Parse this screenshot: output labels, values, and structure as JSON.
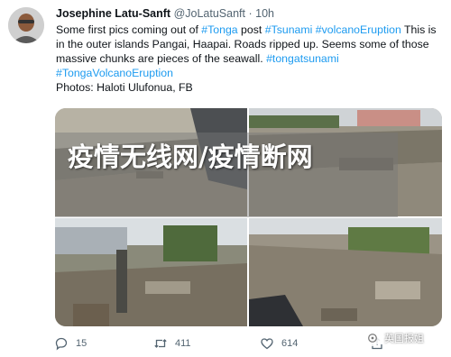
{
  "tweet": {
    "name": "Josephine Latu-Sanft",
    "handle": "@JoLatuSanft",
    "separator": "·",
    "time": "10h",
    "text_1": "Some first pics coming out of ",
    "hashtag_tonga": "#Tonga",
    "text_2": " post ",
    "hashtag_tsunami": "#Tsunami",
    "text_3": " ",
    "hashtag_volcano": "#volcanoEruption",
    "text_4": " This is in the outer islands Pangai, Haapai. Roads ripped up. Seems some of those massive chunks are pieces of the seawall. ",
    "hashtag_tongatsunami": "#tongatsunami",
    "text_5": " ",
    "hashtag_tongavolcano": "#TongaVolcanoEruption",
    "photo_credit": "Photos: Haloti Ulufonua, FB"
  },
  "overlay": {
    "banner_text": "疫情无线网/疫情断网"
  },
  "actions": {
    "reply_count": "15",
    "retweet_count": "411",
    "like_count": "614"
  },
  "watermark": {
    "label": "英国报姐"
  },
  "colors": {
    "hashtag": "#1d9bf0",
    "secondary_text": "#536471"
  },
  "icons": [
    "reply-icon",
    "retweet-icon",
    "like-icon",
    "share-icon"
  ]
}
